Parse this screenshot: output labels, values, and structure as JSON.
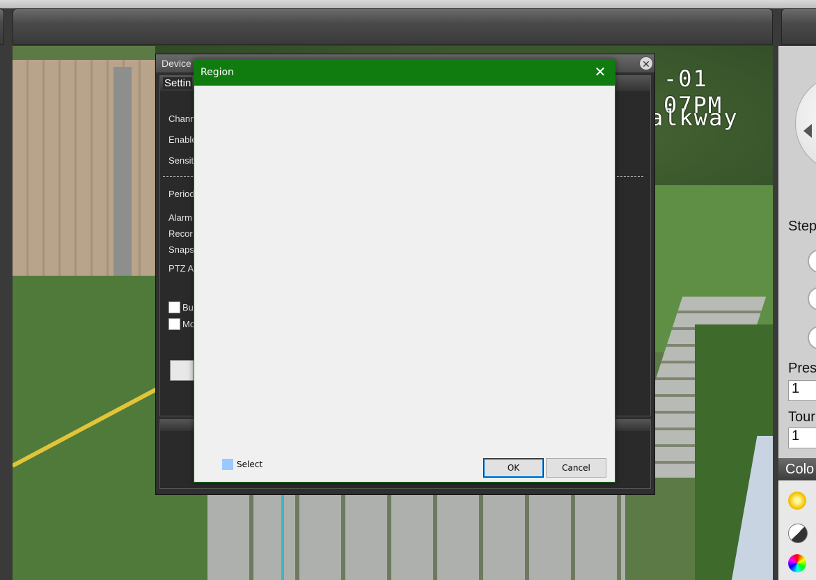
{
  "camera": {
    "osd_time": "-01 07PM",
    "osd_name": "alkway"
  },
  "device_dialog": {
    "title": "Device",
    "tab": "Settin",
    "labels": [
      "Chann",
      "Enable",
      "Sensit",
      "Period",
      "Alarm",
      "Recor",
      "Snaps",
      "PTZ A"
    ],
    "checks": [
      "Bu",
      "Mo"
    ]
  },
  "region_dialog": {
    "title": "Region",
    "close": "✕",
    "legend_label": "Select",
    "ok_label": "OK",
    "cancel_label": "Cancel",
    "legend_color": "#99c9ff",
    "title_color": "#107c10"
  },
  "ptz": {
    "step_label": "Step",
    "preset_label": "Pres",
    "preset_value": "1",
    "tour_label": "Tour",
    "tour_value": "1",
    "color_label": "Colo",
    "icons": [
      "brightness-icon",
      "contrast-icon",
      "color-wheel-icon"
    ]
  }
}
